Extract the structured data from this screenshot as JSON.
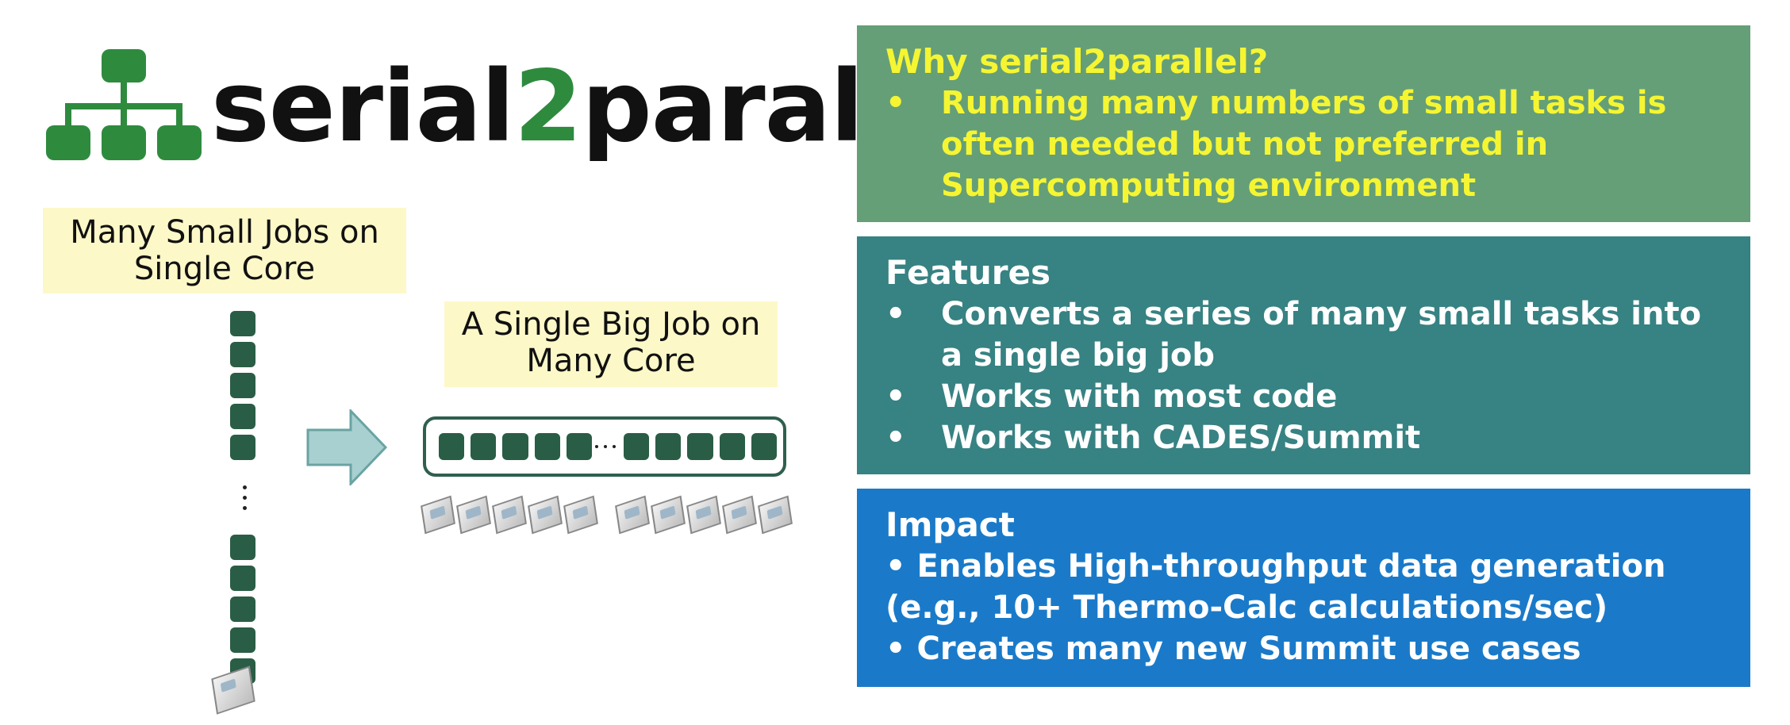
{
  "logo": {
    "prefix": "serial",
    "two": "2",
    "suffix": "parallel"
  },
  "labels": {
    "small_jobs": [
      "Many Small Jobs on",
      "Single Core"
    ],
    "big_job": [
      "A Single Big Job on",
      "Many Core"
    ]
  },
  "panels": {
    "why": {
      "title": "Why serial2parallel?",
      "items": [
        "Running many numbers of small tasks is often needed but not preferred in Supercomputing environment"
      ]
    },
    "features": {
      "title": "Features",
      "items": [
        "Converts a series of many small tasks into a single big job",
        "Works with most code",
        "Works with CADES/Summit"
      ]
    },
    "impact": {
      "title": "Impact",
      "lines": [
        "• Enables High-throughput data generation (e.g., 10+ Thermo-Calc calculations/sec)",
        "• Creates many new Summit use cases"
      ]
    }
  },
  "colors": {
    "why_bg": "#659f78",
    "features_bg": "#378283",
    "impact_bg": "#1a7ac9",
    "why_text": "#f5f532",
    "logo_accent": "#2e8b3e",
    "job_block": "#2a5d45",
    "label_bg": "#fdf8c8"
  },
  "icons": [
    "hierarchy-icon",
    "right-arrow-icon",
    "cpu-chip-icon"
  ]
}
